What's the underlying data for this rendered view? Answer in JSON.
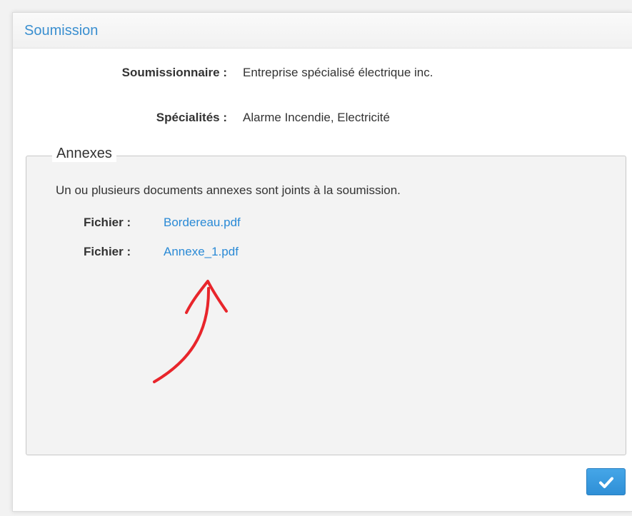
{
  "panel": {
    "title": "Soumission"
  },
  "details": {
    "bidder_label": "Soumissionnaire :",
    "bidder_value": "Entreprise spécialisé électrique inc.",
    "specialties_label": "Spécialités :",
    "specialties_value": "Alarme Incendie, Electricité"
  },
  "annexes": {
    "legend": "Annexes",
    "notice": "Un ou plusieurs documents annexes sont joints à la soumission.",
    "files": [
      {
        "label": "Fichier :",
        "name": "Bordereau.pdf"
      },
      {
        "label": "Fichier :",
        "name": "Annexe_1.pdf"
      }
    ]
  },
  "actions": {
    "confirm_icon": "check-icon"
  },
  "colors": {
    "accent": "#3a8fd0",
    "link": "#2a8ad6",
    "button": "#2f8fd6",
    "annotation_arrow": "#e8252b"
  }
}
